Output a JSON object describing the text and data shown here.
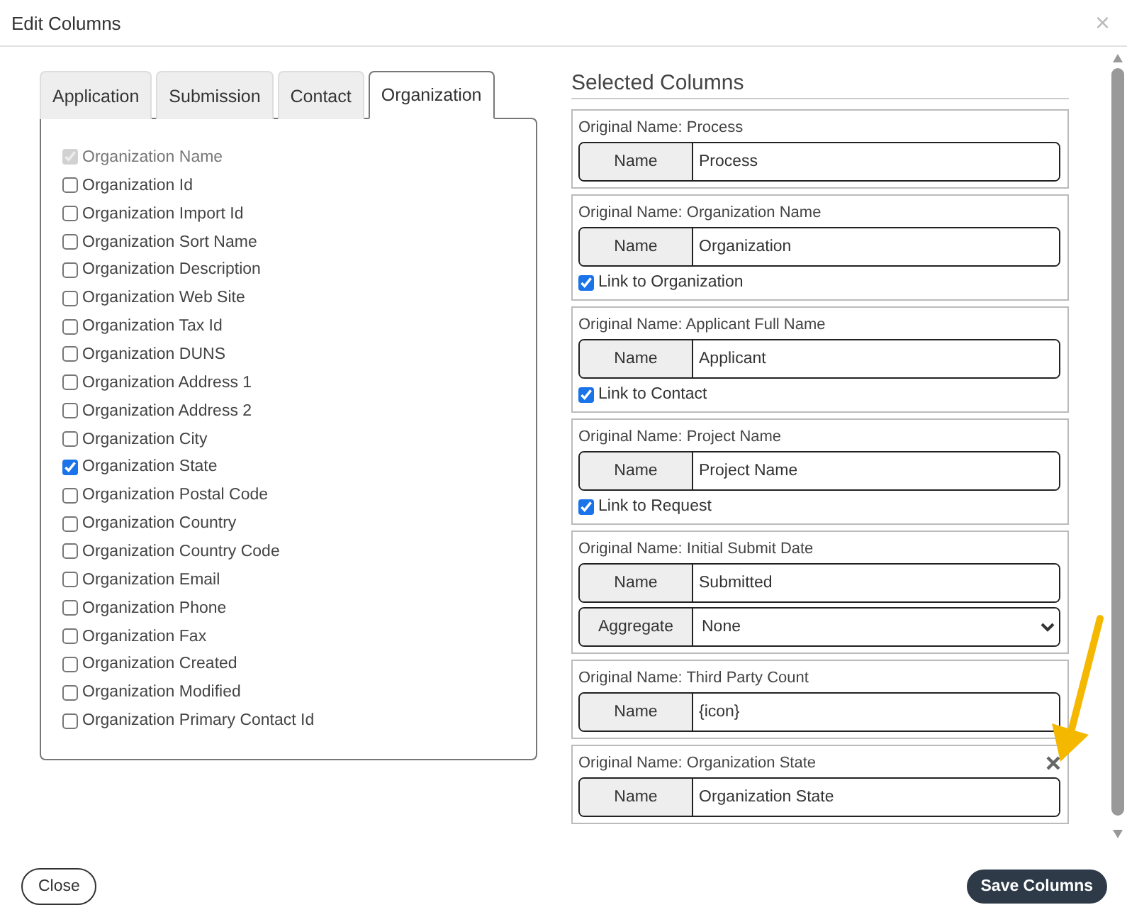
{
  "dialog": {
    "title": "Edit Columns",
    "close_icon": "×"
  },
  "tabs": [
    {
      "label": "Application",
      "selected": false
    },
    {
      "label": "Submission",
      "selected": false
    },
    {
      "label": "Contact",
      "selected": false
    },
    {
      "label": "Organization",
      "selected": true
    }
  ],
  "fields": [
    {
      "label": "Organization Name",
      "checked": true,
      "disabled": true
    },
    {
      "label": "Organization Id",
      "checked": false,
      "disabled": false
    },
    {
      "label": "Organization Import Id",
      "checked": false,
      "disabled": false
    },
    {
      "label": "Organization Sort Name",
      "checked": false,
      "disabled": false
    },
    {
      "label": "Organization Description",
      "checked": false,
      "disabled": false
    },
    {
      "label": "Organization Web Site",
      "checked": false,
      "disabled": false
    },
    {
      "label": "Organization Tax Id",
      "checked": false,
      "disabled": false
    },
    {
      "label": "Organization DUNS",
      "checked": false,
      "disabled": false
    },
    {
      "label": "Organization Address 1",
      "checked": false,
      "disabled": false
    },
    {
      "label": "Organization Address 2",
      "checked": false,
      "disabled": false
    },
    {
      "label": "Organization City",
      "checked": false,
      "disabled": false
    },
    {
      "label": "Organization State",
      "checked": true,
      "disabled": false
    },
    {
      "label": "Organization Postal Code",
      "checked": false,
      "disabled": false
    },
    {
      "label": "Organization Country",
      "checked": false,
      "disabled": false
    },
    {
      "label": "Organization Country Code",
      "checked": false,
      "disabled": false
    },
    {
      "label": "Organization Email",
      "checked": false,
      "disabled": false
    },
    {
      "label": "Organization Phone",
      "checked": false,
      "disabled": false
    },
    {
      "label": "Organization Fax",
      "checked": false,
      "disabled": false
    },
    {
      "label": "Organization Created",
      "checked": false,
      "disabled": false
    },
    {
      "label": "Organization Modified",
      "checked": false,
      "disabled": false
    },
    {
      "label": "Organization Primary Contact Id",
      "checked": false,
      "disabled": false
    }
  ],
  "selected_columns": {
    "heading": "Selected Columns",
    "columns": [
      {
        "original": "Original Name: Process",
        "removable": false,
        "rows": [
          {
            "kind": "text",
            "label": "Name",
            "value": "Process"
          }
        ]
      },
      {
        "original": "Original Name: Organization Name",
        "removable": false,
        "rows": [
          {
            "kind": "text",
            "label": "Name",
            "value": "Organization"
          }
        ],
        "link": {
          "label": "Link to Organization",
          "checked": true
        }
      },
      {
        "original": "Original Name: Applicant Full Name",
        "removable": false,
        "rows": [
          {
            "kind": "text",
            "label": "Name",
            "value": "Applicant"
          }
        ],
        "link": {
          "label": "Link to Contact",
          "checked": true
        }
      },
      {
        "original": "Original Name: Project Name",
        "removable": false,
        "rows": [
          {
            "kind": "text",
            "label": "Name",
            "value": "Project Name"
          }
        ],
        "link": {
          "label": "Link to Request",
          "checked": true
        }
      },
      {
        "original": "Original Name: Initial Submit Date",
        "removable": false,
        "rows": [
          {
            "kind": "text",
            "label": "Name",
            "value": "Submitted"
          },
          {
            "kind": "select",
            "label": "Aggregate",
            "value": "None"
          }
        ]
      },
      {
        "original": "Original Name: Third Party Count",
        "removable": false,
        "rows": [
          {
            "kind": "text",
            "label": "Name",
            "value": "{icon}"
          }
        ]
      },
      {
        "original": "Original Name: Organization State",
        "removable": true,
        "rows": [
          {
            "kind": "text",
            "label": "Name",
            "value": "Organization State"
          }
        ]
      }
    ]
  },
  "footer": {
    "close": "Close",
    "save": "Save Columns"
  }
}
